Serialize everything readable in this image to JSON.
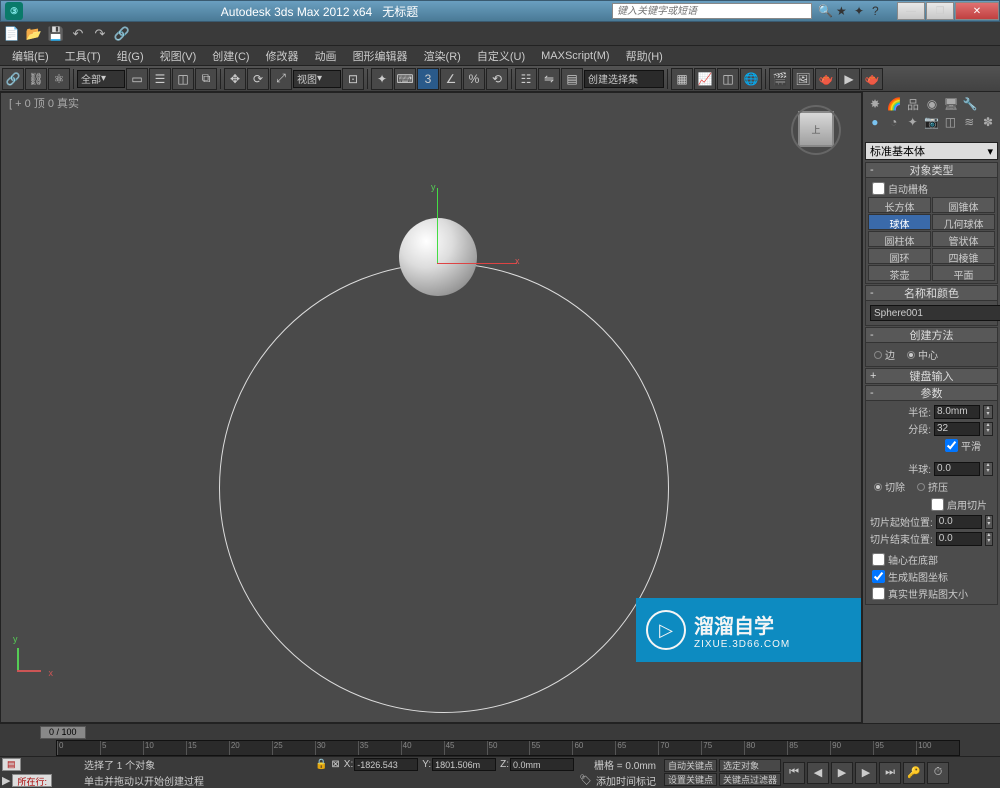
{
  "title": {
    "app": "Autodesk 3ds Max 2012 x64",
    "doc": "无标题",
    "search_placeholder": "键入关键字或短语"
  },
  "menu": [
    "编辑(E)",
    "工具(T)",
    "组(G)",
    "视图(V)",
    "创建(C)",
    "修改器",
    "动画",
    "图形编辑器",
    "渲染(R)",
    "自定义(U)",
    "MAXScript(M)",
    "帮助(H)"
  ],
  "toolbar": {
    "scope": "全部",
    "view_dd": "视图",
    "selection_set": "创建选择集"
  },
  "viewport": {
    "label": "[ + 0 顶 0 真实",
    "axis_x": "x",
    "axis_y": "y",
    "cube_face": "上"
  },
  "panel": {
    "category": "标准基本体",
    "rollout_objtype": "对象类型",
    "auto_grid": "自动栅格",
    "types": [
      [
        "长方体",
        "圆锥体"
      ],
      [
        "球体",
        "几何球体"
      ],
      [
        "圆柱体",
        "管状体"
      ],
      [
        "圆环",
        "四棱锥"
      ],
      [
        "茶壶",
        "平面"
      ]
    ],
    "type_selected": "球体",
    "rollout_name": "名称和颜色",
    "object_name": "Sphere001",
    "rollout_method": "创建方法",
    "method_edge": "边",
    "method_center": "中心",
    "rollout_kb": "键盘输入",
    "rollout_params": "参数",
    "p_radius_lbl": "半径:",
    "p_radius_val": "8.0mm",
    "p_segs_lbl": "分段:",
    "p_segs_val": "32",
    "p_smooth": "平滑",
    "p_hemi_lbl": "半球:",
    "p_hemi_val": "0.0",
    "p_chop": "切除",
    "p_squash": "挤压",
    "p_slice_on": "启用切片",
    "p_slice_from_lbl": "切片起始位置:",
    "p_slice_from_val": "0.0",
    "p_slice_to_lbl": "切片结束位置:",
    "p_slice_to_val": "0.0",
    "p_base_pivot": "轴心在底部",
    "p_gen_uv": "生成贴图坐标",
    "p_real_uv": "真实世界贴图大小"
  },
  "timeline": {
    "slider": "0 / 100",
    "ticks": [
      "0",
      "5",
      "10",
      "15",
      "20",
      "25",
      "30",
      "35",
      "40",
      "45",
      "50",
      "55",
      "60",
      "65",
      "70",
      "75",
      "80",
      "85",
      "90",
      "95",
      "100"
    ]
  },
  "status": {
    "line1": "选择了 1 个对象",
    "line2": "单击并拖动以开始创建过程",
    "add_time_tag": "添加时间标记",
    "x_val": "-1826.543",
    "y_val": "1801.506m",
    "z_val": "0.0mm",
    "grid": "栅格 = 0.0mm",
    "auto_key": "自动关键点",
    "sel_set2": "选定对象",
    "set_key": "设置关键点",
    "key_filter": "关键点过滤器",
    "script_btn": "所在行:"
  },
  "watermark": {
    "brand": "溜溜自学",
    "url": "ZIXUE.3D66.COM"
  }
}
